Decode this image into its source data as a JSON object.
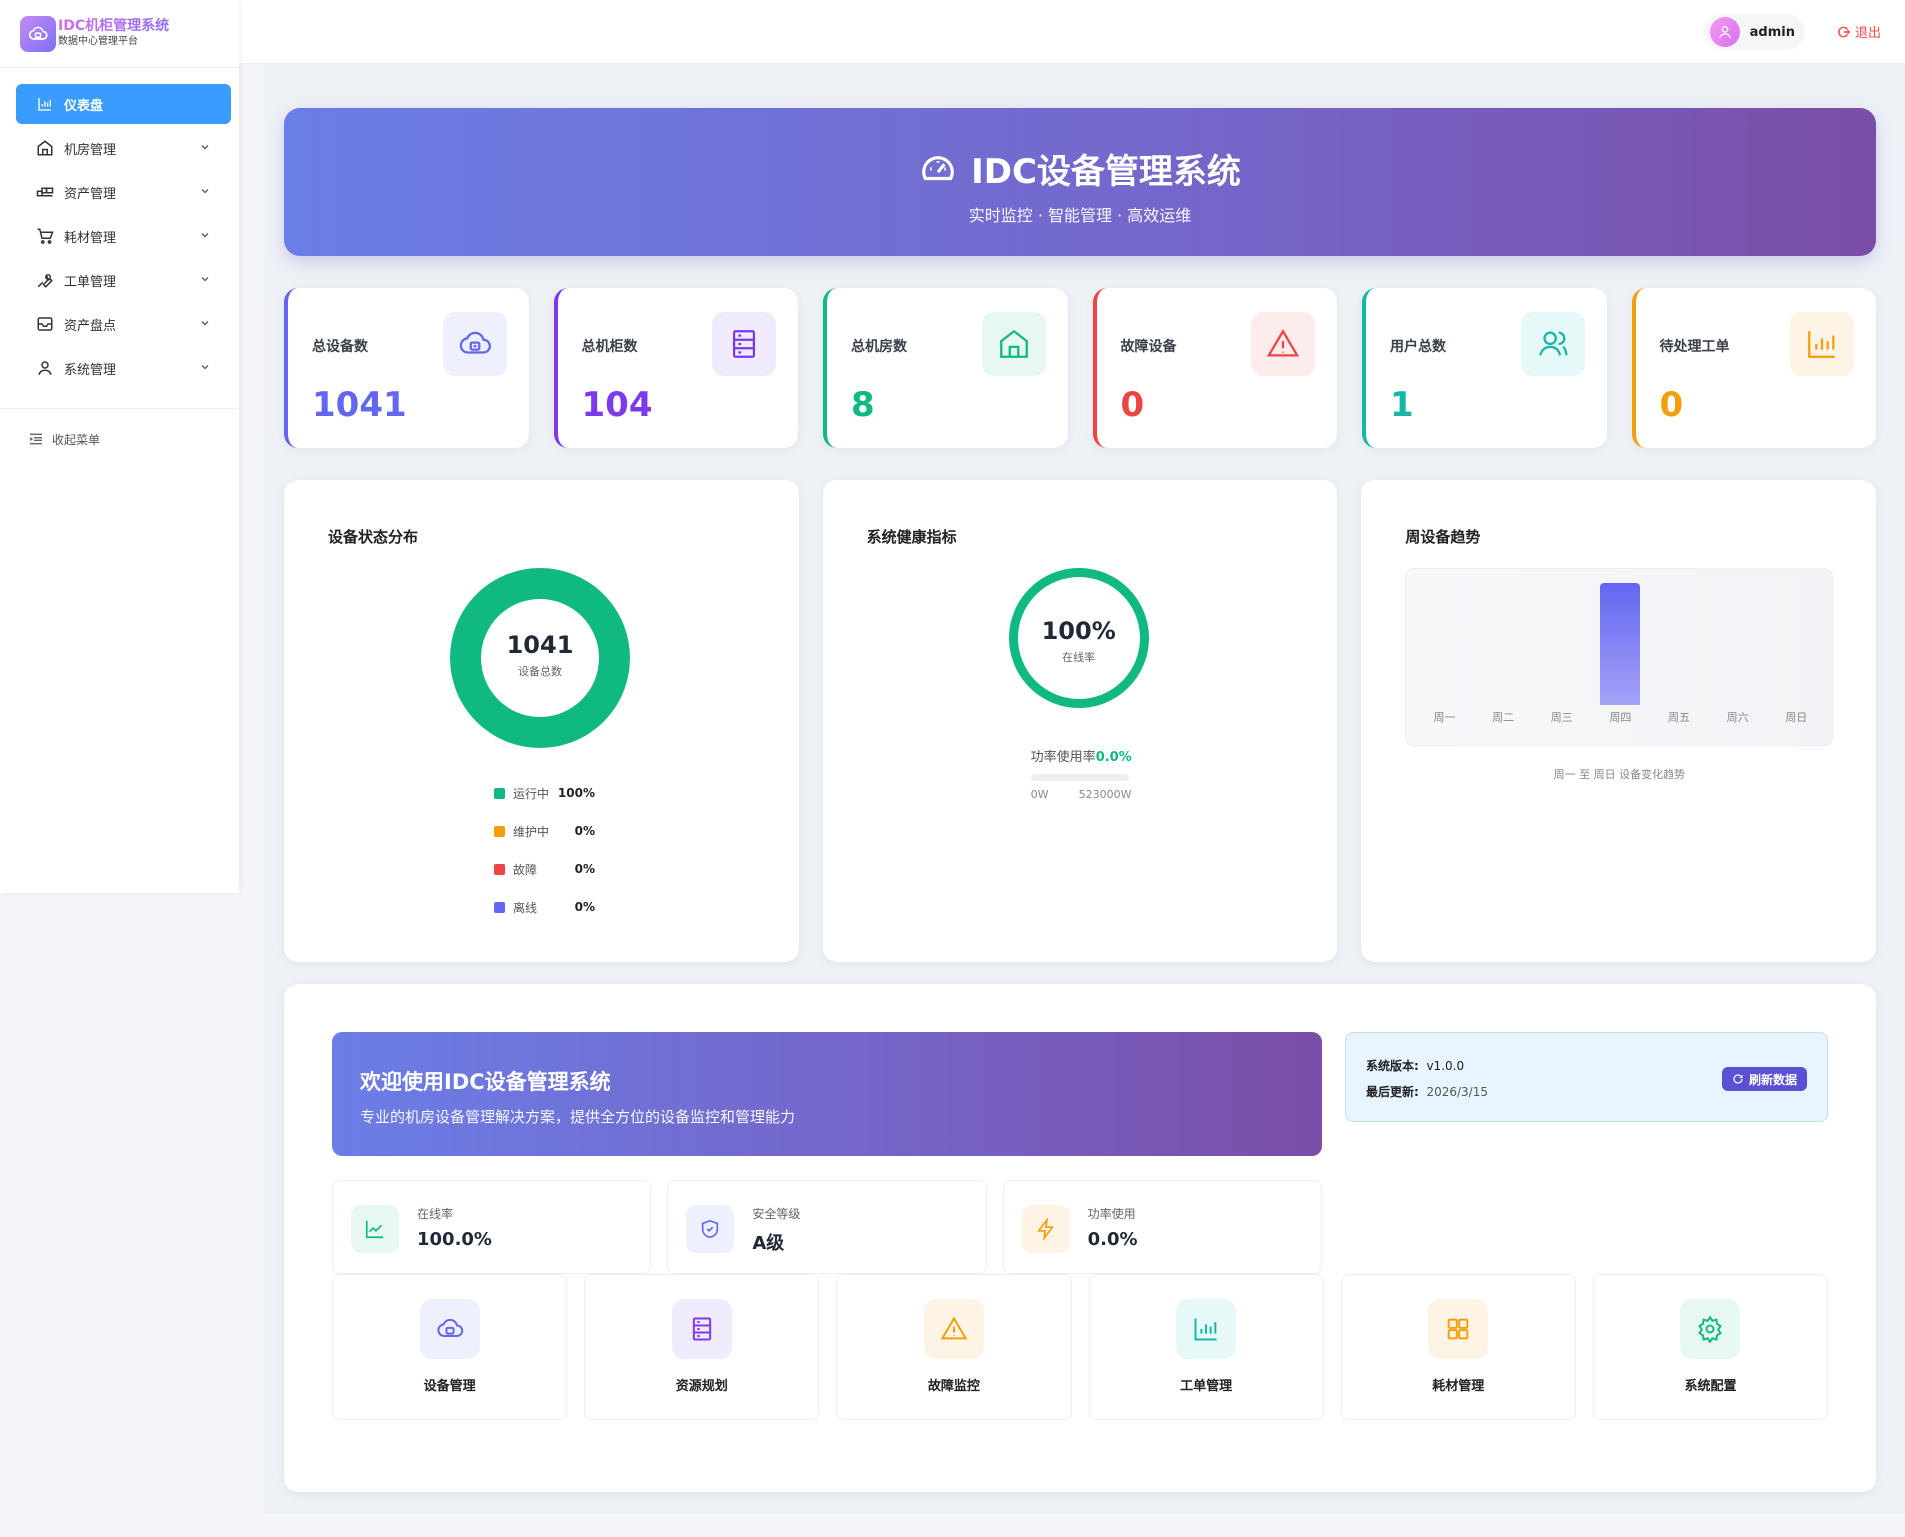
{
  "app": {
    "title": "IDC机柜管理系统",
    "subtitle": "数据中心管理平台"
  },
  "sidebar": {
    "items": [
      {
        "label": "仪表盘",
        "icon": "bar-chart-icon"
      },
      {
        "label": "机房管理",
        "icon": "house-icon"
      },
      {
        "label": "资产管理",
        "icon": "boxes-icon"
      },
      {
        "label": "耗材管理",
        "icon": "cart-icon"
      },
      {
        "label": "工单管理",
        "icon": "wrench-icon"
      },
      {
        "label": "资产盘点",
        "icon": "inbox-icon"
      },
      {
        "label": "系统管理",
        "icon": "user-icon"
      }
    ],
    "collapse_label": "收起菜单"
  },
  "header": {
    "username": "admin",
    "logout_label": "退出"
  },
  "hero": {
    "title": "IDC设备管理系统",
    "subtitle": "实时监控 · 智能管理 · 高效运维"
  },
  "stats": [
    {
      "label": "总设备数",
      "value": "1041",
      "color": "#6366f1",
      "bg": "#eef0fd",
      "icon": "cloud-server-icon"
    },
    {
      "label": "总机柜数",
      "value": "104",
      "color": "#7c3aed",
      "bg": "#f1ecfd",
      "icon": "server-rack-icon"
    },
    {
      "label": "总机房数",
      "value": "8",
      "color": "#10b981",
      "bg": "#e6f8f1",
      "icon": "house-icon"
    },
    {
      "label": "故障设备",
      "value": "0",
      "color": "#ef4444",
      "bg": "#fdecec",
      "icon": "warning-icon"
    },
    {
      "label": "用户总数",
      "value": "1",
      "color": "#14b8a6",
      "bg": "#e6f8f7",
      "icon": "users-icon"
    },
    {
      "label": "待处理工单",
      "value": "0",
      "color": "#f59e0b",
      "bg": "#fef4e6",
      "icon": "bar-chart-icon"
    }
  ],
  "status_panel": {
    "title": "设备状态分布",
    "total": "1041",
    "total_caption": "设备总数",
    "legend": [
      {
        "name": "运行中",
        "value": "100%",
        "color": "#10b981"
      },
      {
        "name": "维护中",
        "value": "0%",
        "color": "#f59e0b"
      },
      {
        "name": "故障",
        "value": "0%",
        "color": "#ef4444"
      },
      {
        "name": "离线",
        "value": "0%",
        "color": "#6366f1"
      }
    ]
  },
  "health_panel": {
    "title": "系统健康指标",
    "value": "100%",
    "caption": "在线率",
    "power_label": "功率使用率",
    "power_value": "0.0%",
    "power_min": "0W",
    "power_max": "523000W"
  },
  "trend_panel": {
    "title": "周设备趋势",
    "note": "周一 至 周日 设备变化趋势",
    "chart_data": {
      "type": "bar",
      "categories": [
        "周一",
        "周二",
        "周三",
        "周四",
        "周五",
        "周六",
        "周日"
      ],
      "values": [
        0,
        0,
        0,
        1041,
        0,
        0,
        0
      ],
      "title": "周设备趋势",
      "xlabel": "",
      "ylabel": "",
      "grid": false,
      "color": "#6366f1"
    }
  },
  "welcome": {
    "title": "欢迎使用IDC设备管理系统",
    "subtitle": "专业的机房设备管理解决方案，提供全方位的设备监控和管理能力",
    "version_label": "系统版本:",
    "version": "v1.0.0",
    "updated_label": "最后更新:",
    "updated": "2026/3/15",
    "refresh_label": "刷新数据",
    "metrics": [
      {
        "label": "在线率",
        "value": "100.0%",
        "color": "#10b981",
        "bg": "#e6f8f1",
        "icon": "trend-line-icon"
      },
      {
        "label": "安全等级",
        "value": "A级",
        "color": "#6366f1",
        "bg": "#eef0fd",
        "icon": "shield-icon"
      },
      {
        "label": "功率使用",
        "value": "0.0%",
        "color": "#f59e0b",
        "bg": "#fef4e6",
        "icon": "lightning-icon"
      }
    ],
    "quick_links": [
      {
        "label": "设备管理",
        "color": "#6366f1",
        "bg": "#eef0fd",
        "icon": "cloud-server-icon"
      },
      {
        "label": "资源规划",
        "color": "#7c3aed",
        "bg": "#f1ecfd",
        "icon": "server-rack-icon"
      },
      {
        "label": "故障监控",
        "color": "#f59e0b",
        "bg": "#fef4e6",
        "icon": "warning-icon"
      },
      {
        "label": "工单管理",
        "color": "#14b8a6",
        "bg": "#e6f8f7",
        "icon": "bar-chart-icon"
      },
      {
        "label": "耗材管理",
        "color": "#f59e0b",
        "bg": "#fef4e6",
        "icon": "grid-icon"
      },
      {
        "label": "系统配置",
        "color": "#10b981",
        "bg": "#e6f8f1",
        "icon": "gear-icon"
      }
    ]
  }
}
